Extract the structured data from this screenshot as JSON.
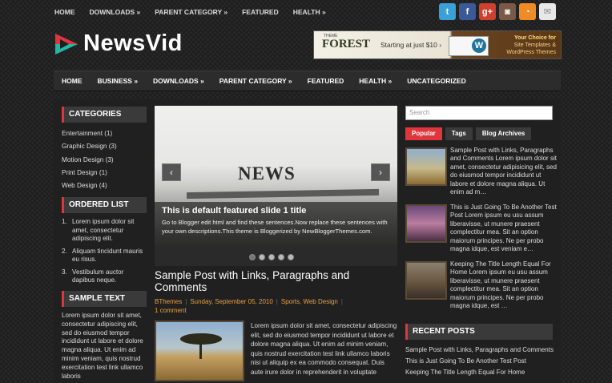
{
  "top_nav": [
    "HOME",
    "DOWNLOADS »",
    "PARENT CATEGORY »",
    "FEATURED",
    "HEALTH »"
  ],
  "social": [
    {
      "icon": "twitter-icon",
      "glyph": "t",
      "color": "#3aa0d8"
    },
    {
      "icon": "facebook-icon",
      "glyph": "f",
      "color": "#3b5998"
    },
    {
      "icon": "google-plus-icon",
      "glyph": "g+",
      "color": "#d0402f"
    },
    {
      "icon": "instagram-icon",
      "glyph": "◙",
      "color": "#7a5a46"
    },
    {
      "icon": "rss-icon",
      "glyph": "◔",
      "color": "#f08a24"
    },
    {
      "icon": "email-icon",
      "glyph": "✉",
      "color": "#e8e8e8"
    }
  ],
  "site": {
    "title": "NewsVid",
    "accent": "#e0353b",
    "logo_colors": [
      "#e0353b",
      "#21b8a6"
    ]
  },
  "banner": {
    "brand": "FOREST",
    "brand_small": "THEME",
    "start": "Starting at just $10 ›",
    "choice_1": "Your Choice for",
    "choice_2": "Site Templates &",
    "choice_3": "WordPress Themes"
  },
  "main_nav": [
    "HOME",
    "BUSINESS »",
    "DOWNLOADS »",
    "PARENT CATEGORY »",
    "FEATURED",
    "HEALTH »",
    "UNCATEGORIZED"
  ],
  "categories": {
    "title": "CATEGORIES",
    "items": [
      "Entertainment (1)",
      "Graphic Design (3)",
      "Motion Design (3)",
      "Print Design (1)",
      "Web Design (4)"
    ]
  },
  "ordered_list": {
    "title": "ORDERED LIST",
    "items": [
      {
        "n": "1.",
        "text": "Lorem ipsum dolor sit amet, consectetur adipiscing elit."
      },
      {
        "n": "2.",
        "text": "Aliquam tincidunt mauris eu risus."
      },
      {
        "n": "3.",
        "text": "Vestibulum auctor dapibus neque."
      }
    ]
  },
  "sample_text": {
    "title": "SAMPLE TEXT",
    "body": "Lorem ipsum dolor sit amet, consectetur adipiscing elit, sed do eiusmod tempor incididunt ut labore et dolore magna aliqua. Ut enim ad minim veniam, quis nostrud exercitation test link ullamco laboris"
  },
  "slider": {
    "image_word": "NEWS",
    "caption_title": "This is default featured slide 1 title",
    "caption_body": "Go to Blogger edit html and find these sentences.Now replace these sentences with your own descriptions.This theme is Bloggerized by NewBloggerThemes.com.",
    "prev": "‹",
    "next": "›",
    "dots": 5,
    "active_dot": 0
  },
  "post": {
    "title": "Sample Post with Links, Paragraphs and Comments",
    "author": "BThemes",
    "date": "Sunday, September 05, 2010",
    "labels": "Sports, Web Design",
    "comments": "1 comment",
    "excerpt": "Lorem ipsum dolor sit amet, consectetur adipiscing elit, sed do eiusmod tempor incididunt ut labore et dolore magna aliqua. Ut enim ad minim veniam, quis nostrud exercitation test link ullamco laboris nisi ut aliquip ex ea commodo consequat. Duis aute irure dolor in reprehenderit in voluptate"
  },
  "search": {
    "placeholder": "Search"
  },
  "tabs": [
    "Popular",
    "Tags",
    "Blog Archives"
  ],
  "popular": [
    {
      "text": "Sample Post with Links, Paragraphs and Comments Lorem ipsum dolor sit amet, consectetur adipisicing elit, sed do eiusmod tempor incididunt ut labore et dolore magna aliqua. Ut enim ad m…"
    },
    {
      "text": "This is Just Going To Be Another Test Post Lorem ipsum eu usu assum liberavisse, ut munere praesent complectitur mea. Sit an option maiorum principes. Ne per probo magna idque, est veniam e…"
    },
    {
      "text": "Keeping The Title Length Equal For Home Lorem ipsum eu usu assum liberavisse, ut munere praesent complectitur mea. Sit an option maiorum principes. Ne per probo magna idque, est …"
    }
  ],
  "recent_posts": {
    "title": "RECENT POSTS",
    "items": [
      "Sample Post with Links, Paragraphs and Comments",
      "This is Just Going To Be Another Test Post",
      "Keeping The Title Length Equal For Home"
    ]
  }
}
